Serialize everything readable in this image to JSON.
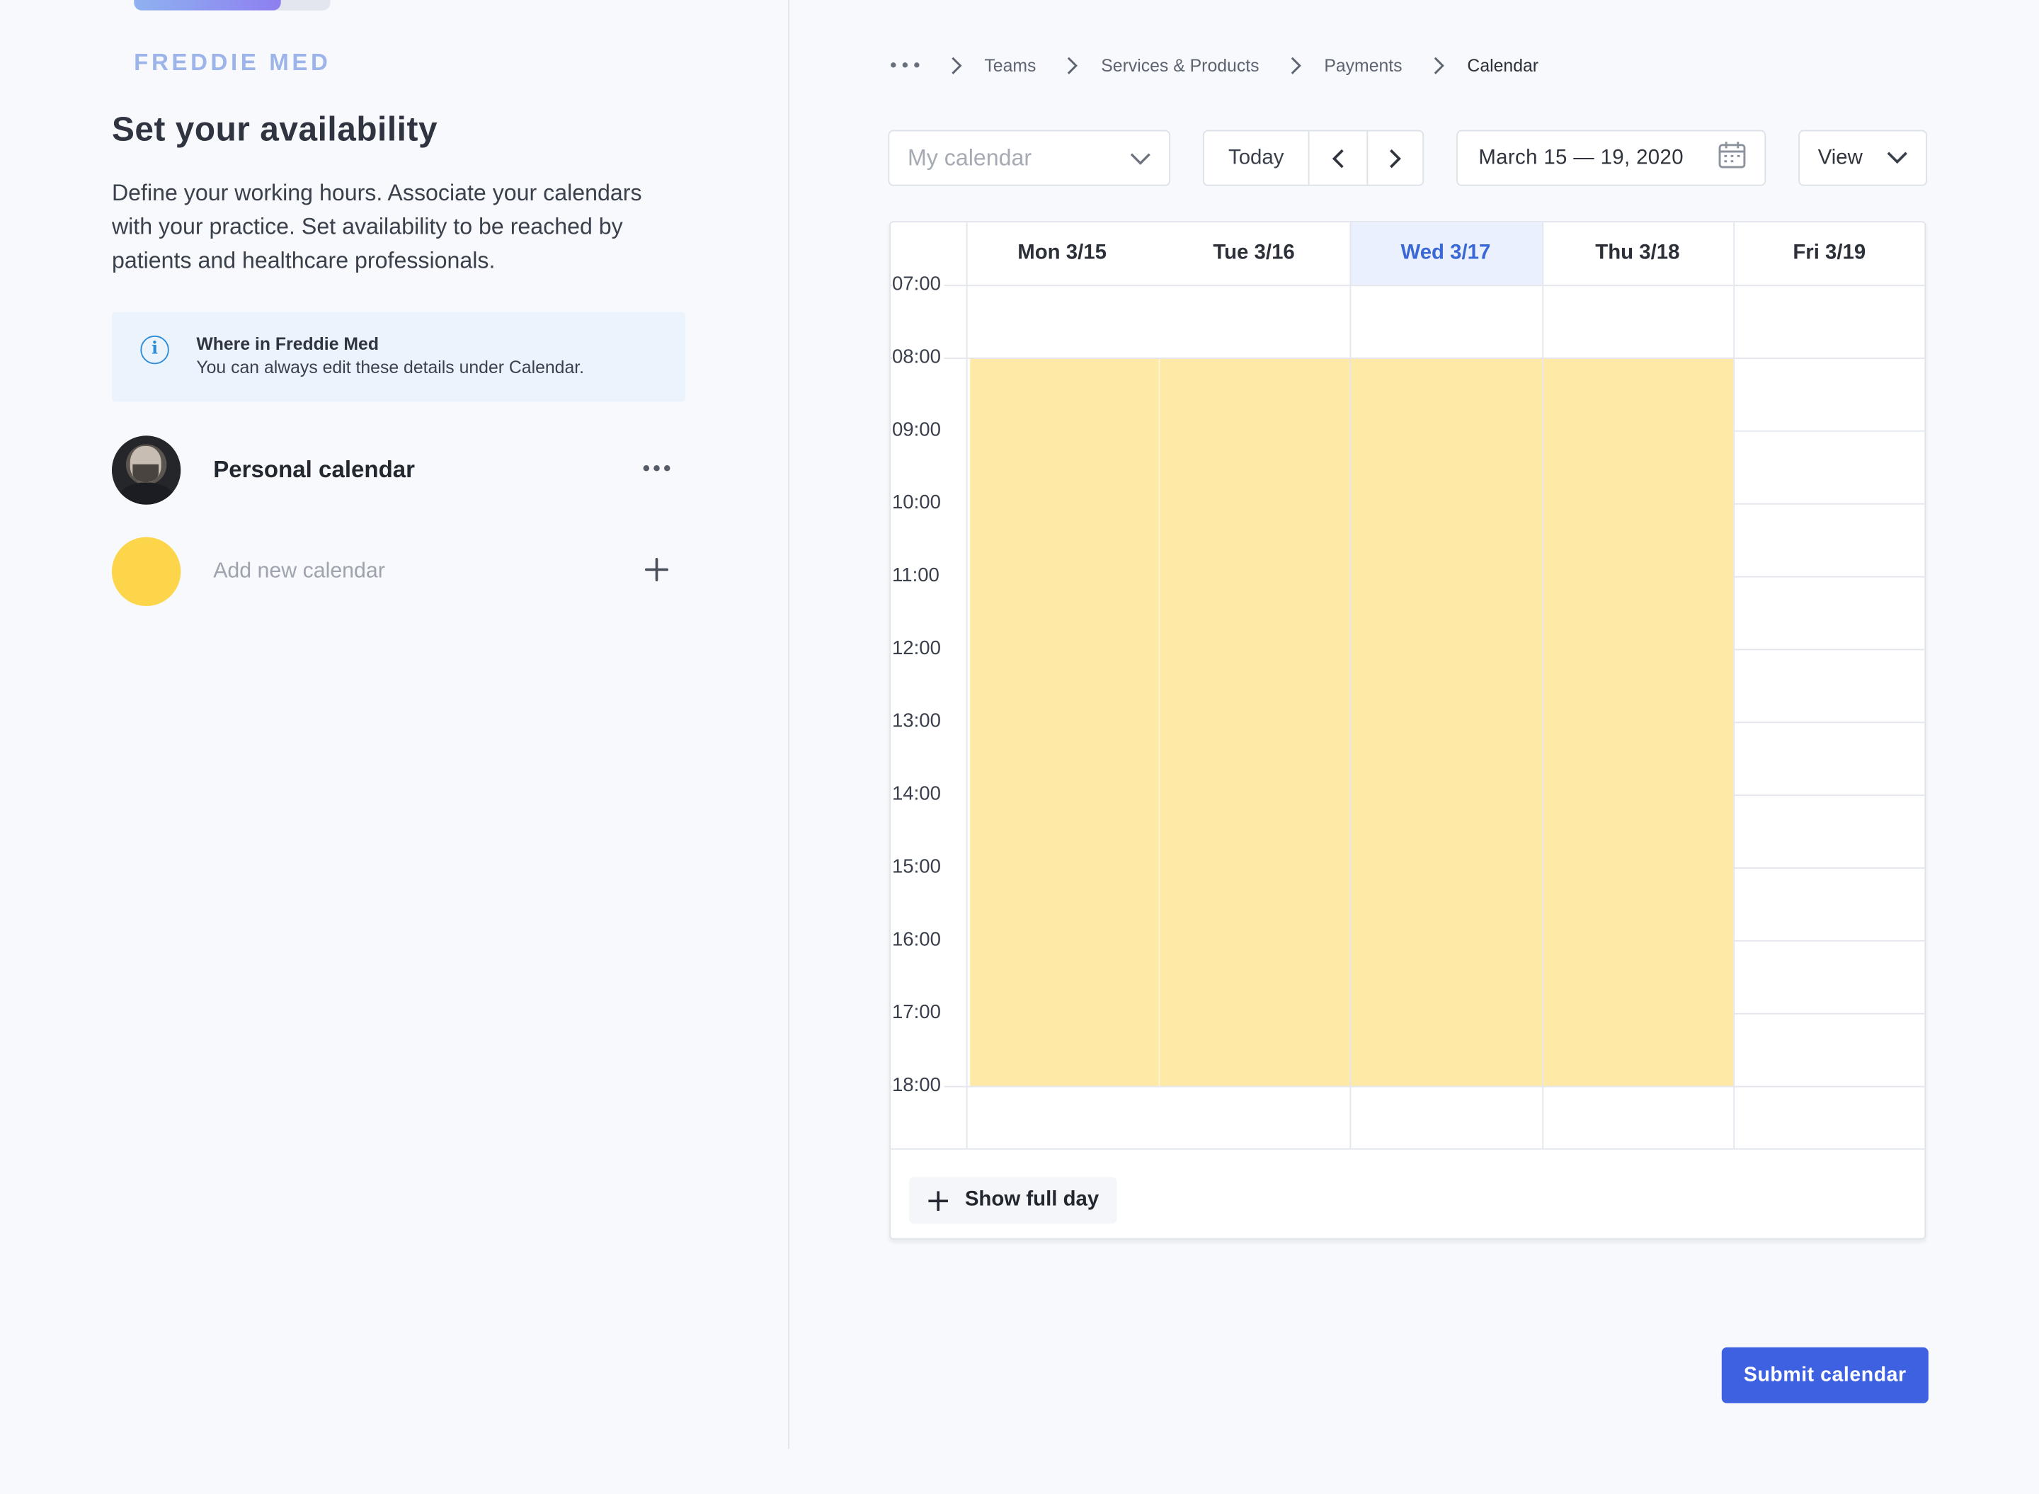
{
  "progress": {
    "fraction": 0.75
  },
  "brand": {
    "logo": "FREDDIE MED"
  },
  "onboarding": {
    "title": "Set your availability",
    "description": "Define your working hours. Associate your calendars with your practice. Set availability to be reached by patients and healthcare professionals.",
    "info_title": "Where in Freddie Med",
    "info_text": "You can always edit these details under Calendar."
  },
  "calendars": {
    "personal": "Personal calendar",
    "add_new": "Add new calendar"
  },
  "breadcrumb": [
    "Teams",
    "Services & Products",
    "Payments",
    "Calendar"
  ],
  "toolbar": {
    "calendar_select_placeholder": "My calendar",
    "today": "Today",
    "date_range": "March 15 — 19, 2020",
    "view": "View"
  },
  "week": {
    "days": [
      {
        "label": "Mon 3/15",
        "active": false,
        "available": true
      },
      {
        "label": "Tue 3/16",
        "active": false,
        "available": true
      },
      {
        "label": "Wed 3/17",
        "active": true,
        "available": true
      },
      {
        "label": "Thu 3/18",
        "active": false,
        "available": true
      },
      {
        "label": "Fri 3/19",
        "active": false,
        "available": false
      }
    ],
    "hours": [
      "07:00",
      "08:00",
      "09:00",
      "10:00",
      "11:00",
      "12:00",
      "13:00",
      "14:00",
      "15:00",
      "16:00",
      "17:00",
      "18:00"
    ],
    "availability": {
      "start": "08:00",
      "end": "18:00"
    },
    "show_full_day": "Show full day"
  },
  "actions": {
    "submit": "Submit calendar"
  },
  "colors": {
    "accent": "#3e61e2",
    "availability": "#ffe9a6",
    "active_day": "#eaf0fd",
    "avatar_placeholder": "#fdd54a"
  },
  "icons": {
    "info": "info-icon",
    "more": "more-horizontal-icon",
    "add": "plus-icon",
    "calendar": "calendar-icon"
  }
}
